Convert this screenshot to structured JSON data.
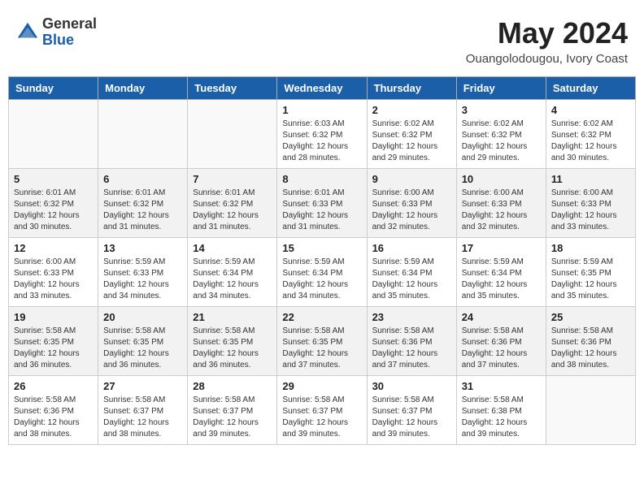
{
  "header": {
    "logo_general": "General",
    "logo_blue": "Blue",
    "month_year": "May 2024",
    "location": "Ouangolodougou, Ivory Coast"
  },
  "days_of_week": [
    "Sunday",
    "Monday",
    "Tuesday",
    "Wednesday",
    "Thursday",
    "Friday",
    "Saturday"
  ],
  "weeks": [
    {
      "shaded": false,
      "days": [
        {
          "number": "",
          "sunrise": "",
          "sunset": "",
          "daylight": ""
        },
        {
          "number": "",
          "sunrise": "",
          "sunset": "",
          "daylight": ""
        },
        {
          "number": "",
          "sunrise": "",
          "sunset": "",
          "daylight": ""
        },
        {
          "number": "1",
          "sunrise": "Sunrise: 6:03 AM",
          "sunset": "Sunset: 6:32 PM",
          "daylight": "Daylight: 12 hours and 28 minutes."
        },
        {
          "number": "2",
          "sunrise": "Sunrise: 6:02 AM",
          "sunset": "Sunset: 6:32 PM",
          "daylight": "Daylight: 12 hours and 29 minutes."
        },
        {
          "number": "3",
          "sunrise": "Sunrise: 6:02 AM",
          "sunset": "Sunset: 6:32 PM",
          "daylight": "Daylight: 12 hours and 29 minutes."
        },
        {
          "number": "4",
          "sunrise": "Sunrise: 6:02 AM",
          "sunset": "Sunset: 6:32 PM",
          "daylight": "Daylight: 12 hours and 30 minutes."
        }
      ]
    },
    {
      "shaded": true,
      "days": [
        {
          "number": "5",
          "sunrise": "Sunrise: 6:01 AM",
          "sunset": "Sunset: 6:32 PM",
          "daylight": "Daylight: 12 hours and 30 minutes."
        },
        {
          "number": "6",
          "sunrise": "Sunrise: 6:01 AM",
          "sunset": "Sunset: 6:32 PM",
          "daylight": "Daylight: 12 hours and 31 minutes."
        },
        {
          "number": "7",
          "sunrise": "Sunrise: 6:01 AM",
          "sunset": "Sunset: 6:32 PM",
          "daylight": "Daylight: 12 hours and 31 minutes."
        },
        {
          "number": "8",
          "sunrise": "Sunrise: 6:01 AM",
          "sunset": "Sunset: 6:33 PM",
          "daylight": "Daylight: 12 hours and 31 minutes."
        },
        {
          "number": "9",
          "sunrise": "Sunrise: 6:00 AM",
          "sunset": "Sunset: 6:33 PM",
          "daylight": "Daylight: 12 hours and 32 minutes."
        },
        {
          "number": "10",
          "sunrise": "Sunrise: 6:00 AM",
          "sunset": "Sunset: 6:33 PM",
          "daylight": "Daylight: 12 hours and 32 minutes."
        },
        {
          "number": "11",
          "sunrise": "Sunrise: 6:00 AM",
          "sunset": "Sunset: 6:33 PM",
          "daylight": "Daylight: 12 hours and 33 minutes."
        }
      ]
    },
    {
      "shaded": false,
      "days": [
        {
          "number": "12",
          "sunrise": "Sunrise: 6:00 AM",
          "sunset": "Sunset: 6:33 PM",
          "daylight": "Daylight: 12 hours and 33 minutes."
        },
        {
          "number": "13",
          "sunrise": "Sunrise: 5:59 AM",
          "sunset": "Sunset: 6:33 PM",
          "daylight": "Daylight: 12 hours and 34 minutes."
        },
        {
          "number": "14",
          "sunrise": "Sunrise: 5:59 AM",
          "sunset": "Sunset: 6:34 PM",
          "daylight": "Daylight: 12 hours and 34 minutes."
        },
        {
          "number": "15",
          "sunrise": "Sunrise: 5:59 AM",
          "sunset": "Sunset: 6:34 PM",
          "daylight": "Daylight: 12 hours and 34 minutes."
        },
        {
          "number": "16",
          "sunrise": "Sunrise: 5:59 AM",
          "sunset": "Sunset: 6:34 PM",
          "daylight": "Daylight: 12 hours and 35 minutes."
        },
        {
          "number": "17",
          "sunrise": "Sunrise: 5:59 AM",
          "sunset": "Sunset: 6:34 PM",
          "daylight": "Daylight: 12 hours and 35 minutes."
        },
        {
          "number": "18",
          "sunrise": "Sunrise: 5:59 AM",
          "sunset": "Sunset: 6:35 PM",
          "daylight": "Daylight: 12 hours and 35 minutes."
        }
      ]
    },
    {
      "shaded": true,
      "days": [
        {
          "number": "19",
          "sunrise": "Sunrise: 5:58 AM",
          "sunset": "Sunset: 6:35 PM",
          "daylight": "Daylight: 12 hours and 36 minutes."
        },
        {
          "number": "20",
          "sunrise": "Sunrise: 5:58 AM",
          "sunset": "Sunset: 6:35 PM",
          "daylight": "Daylight: 12 hours and 36 minutes."
        },
        {
          "number": "21",
          "sunrise": "Sunrise: 5:58 AM",
          "sunset": "Sunset: 6:35 PM",
          "daylight": "Daylight: 12 hours and 36 minutes."
        },
        {
          "number": "22",
          "sunrise": "Sunrise: 5:58 AM",
          "sunset": "Sunset: 6:35 PM",
          "daylight": "Daylight: 12 hours and 37 minutes."
        },
        {
          "number": "23",
          "sunrise": "Sunrise: 5:58 AM",
          "sunset": "Sunset: 6:36 PM",
          "daylight": "Daylight: 12 hours and 37 minutes."
        },
        {
          "number": "24",
          "sunrise": "Sunrise: 5:58 AM",
          "sunset": "Sunset: 6:36 PM",
          "daylight": "Daylight: 12 hours and 37 minutes."
        },
        {
          "number": "25",
          "sunrise": "Sunrise: 5:58 AM",
          "sunset": "Sunset: 6:36 PM",
          "daylight": "Daylight: 12 hours and 38 minutes."
        }
      ]
    },
    {
      "shaded": false,
      "days": [
        {
          "number": "26",
          "sunrise": "Sunrise: 5:58 AM",
          "sunset": "Sunset: 6:36 PM",
          "daylight": "Daylight: 12 hours and 38 minutes."
        },
        {
          "number": "27",
          "sunrise": "Sunrise: 5:58 AM",
          "sunset": "Sunset: 6:37 PM",
          "daylight": "Daylight: 12 hours and 38 minutes."
        },
        {
          "number": "28",
          "sunrise": "Sunrise: 5:58 AM",
          "sunset": "Sunset: 6:37 PM",
          "daylight": "Daylight: 12 hours and 39 minutes."
        },
        {
          "number": "29",
          "sunrise": "Sunrise: 5:58 AM",
          "sunset": "Sunset: 6:37 PM",
          "daylight": "Daylight: 12 hours and 39 minutes."
        },
        {
          "number": "30",
          "sunrise": "Sunrise: 5:58 AM",
          "sunset": "Sunset: 6:37 PM",
          "daylight": "Daylight: 12 hours and 39 minutes."
        },
        {
          "number": "31",
          "sunrise": "Sunrise: 5:58 AM",
          "sunset": "Sunset: 6:38 PM",
          "daylight": "Daylight: 12 hours and 39 minutes."
        },
        {
          "number": "",
          "sunrise": "",
          "sunset": "",
          "daylight": ""
        }
      ]
    }
  ]
}
